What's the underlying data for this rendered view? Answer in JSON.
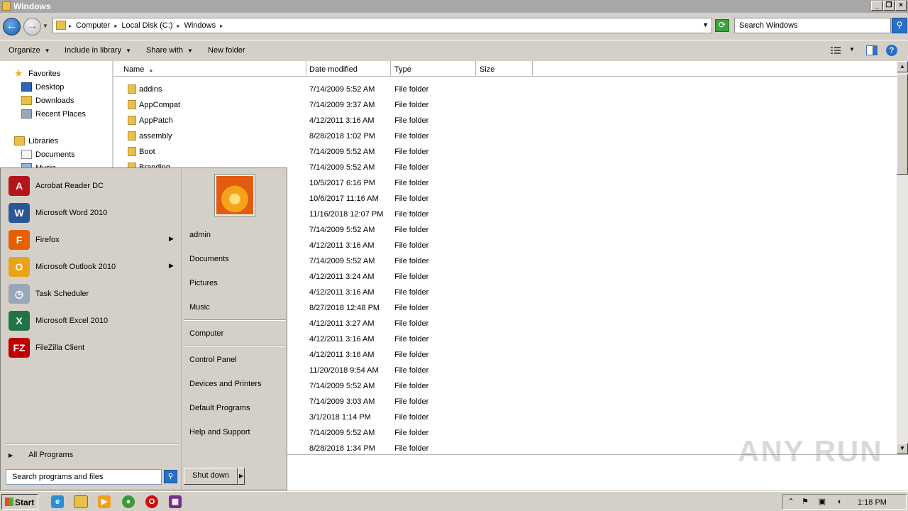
{
  "window": {
    "title": "Windows"
  },
  "address": {
    "crumbs": [
      "Computer",
      "Local Disk (C:)",
      "Windows"
    ],
    "search_placeholder": "Search Windows"
  },
  "toolbar": {
    "organize": "Organize",
    "include_in_library": "Include in library",
    "share_with": "Share with",
    "new_folder": "New folder"
  },
  "nav": {
    "favorites": "Favorites",
    "desktop": "Desktop",
    "downloads": "Downloads",
    "recent_places": "Recent Places",
    "libraries": "Libraries",
    "documents": "Documents",
    "music_partial": "Music"
  },
  "columns": {
    "name": "Name",
    "date": "Date modified",
    "type": "Type",
    "size": "Size"
  },
  "files": [
    {
      "name": "addins",
      "date": "7/14/2009 5:52 AM",
      "type": "File folder"
    },
    {
      "name": "AppCompat",
      "date": "7/14/2009 3:37 AM",
      "type": "File folder"
    },
    {
      "name": "AppPatch",
      "date": "4/12/2011 3:16 AM",
      "type": "File folder"
    },
    {
      "name": "assembly",
      "date": "8/28/2018 1:02 PM",
      "type": "File folder"
    },
    {
      "name": "Boot",
      "date": "7/14/2009 5:52 AM",
      "type": "File folder"
    },
    {
      "name": "Branding",
      "date": "7/14/2009 5:52 AM",
      "type": "File folder"
    },
    {
      "name": "",
      "date": "10/5/2017 6:16 PM",
      "type": "File folder"
    },
    {
      "name": "",
      "date": "10/6/2017 11:16 AM",
      "type": "File folder"
    },
    {
      "name": "",
      "date": "11/16/2018 12:07 PM",
      "type": "File folder"
    },
    {
      "name": "",
      "date": "7/14/2009 5:52 AM",
      "type": "File folder"
    },
    {
      "name": "",
      "date": "4/12/2011 3:16 AM",
      "type": "File folder"
    },
    {
      "name": "",
      "date": "7/14/2009 5:52 AM",
      "type": "File folder"
    },
    {
      "name": "",
      "date": "4/12/2011 3:24 AM",
      "type": "File folder"
    },
    {
      "name": "",
      "date": "4/12/2011 3:16 AM",
      "type": "File folder"
    },
    {
      "name": "",
      "date": "8/27/2018 12:48 PM",
      "type": "File folder"
    },
    {
      "name": "",
      "date": "4/12/2011 3:27 AM",
      "type": "File folder"
    },
    {
      "name": "",
      "date": "4/12/2011 3:16 AM",
      "type": "File folder"
    },
    {
      "name": "",
      "date": "4/12/2011 3:16 AM",
      "type": "File folder"
    },
    {
      "name": "",
      "date": "11/20/2018 9:54 AM",
      "type": "File folder"
    },
    {
      "name": "",
      "date": "7/14/2009 5:52 AM",
      "type": "File folder"
    },
    {
      "name": "",
      "date": "7/14/2009 3:03 AM",
      "type": "File folder"
    },
    {
      "name": "",
      "date": "3/1/2018 1:14 PM",
      "type": "File folder"
    },
    {
      "name": "",
      "date": "7/14/2009 5:52 AM",
      "type": "File folder"
    },
    {
      "name": "",
      "date": "8/28/2018 1:34 PM",
      "type": "File folder"
    }
  ],
  "start_menu": {
    "programs": [
      {
        "label": "Acrobat Reader DC",
        "icon": "acrobat-icon",
        "color": "#b3151b",
        "glyph": "A",
        "arrow": false
      },
      {
        "label": "Microsoft Word 2010",
        "icon": "word-icon",
        "color": "#2b5797",
        "glyph": "W",
        "arrow": false
      },
      {
        "label": "Firefox",
        "icon": "firefox-icon",
        "color": "#e66000",
        "glyph": "F",
        "arrow": true
      },
      {
        "label": "Microsoft Outlook 2010",
        "icon": "outlook-icon",
        "color": "#e8a317",
        "glyph": "O",
        "arrow": true
      },
      {
        "label": "Task Scheduler",
        "icon": "clock-icon",
        "color": "#9aa7b8",
        "glyph": "◷",
        "arrow": false
      },
      {
        "label": "Microsoft Excel 2010",
        "icon": "excel-icon",
        "color": "#217346",
        "glyph": "X",
        "arrow": false
      },
      {
        "label": "FileZilla Client",
        "icon": "filezilla-icon",
        "color": "#bf0000",
        "glyph": "FZ",
        "arrow": false
      }
    ],
    "all_programs": "All Programs",
    "search_placeholder": "Search programs and files",
    "right_items": {
      "admin": "admin",
      "documents": "Documents",
      "pictures": "Pictures",
      "music": "Music",
      "computer": "Computer",
      "control_panel": "Control Panel",
      "devices": "Devices and Printers",
      "default_programs": "Default Programs",
      "help": "Help and Support"
    },
    "shutdown": "Shut down"
  },
  "taskbar": {
    "start": "Start",
    "clock": "1:18 PM"
  },
  "watermark": "ANY RUN"
}
